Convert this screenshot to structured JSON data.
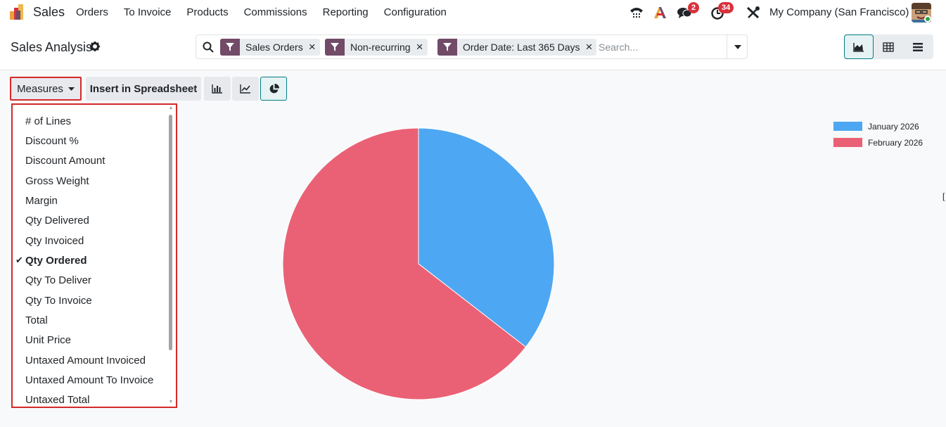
{
  "navbar": {
    "app_name": "Sales",
    "menu": [
      "Orders",
      "To Invoice",
      "Products",
      "Commissions",
      "Reporting",
      "Configuration"
    ],
    "messages_badge": "2",
    "activities_badge": "34",
    "company": "My Company (San Francisco)"
  },
  "control": {
    "title": "Sales Analysis",
    "facets": [
      "Sales Orders",
      "Non-recurring",
      "Order Date: Last 365 Days"
    ],
    "search_placeholder": "Search..."
  },
  "toolbar": {
    "measures_label": "Measures",
    "insert_label": "Insert in Spreadsheet"
  },
  "measures": {
    "items": [
      "# of Lines",
      "Discount %",
      "Discount Amount",
      "Gross Weight",
      "Margin",
      "Qty Delivered",
      "Qty Invoiced",
      "Qty Ordered",
      "Qty To Deliver",
      "Qty To Invoice",
      "Total",
      "Unit Price",
      "Untaxed Amount Invoiced",
      "Untaxed Amount To Invoice",
      "Untaxed Total"
    ],
    "selected": "Qty Ordered"
  },
  "colors": {
    "accent": "#017e84",
    "facet": "#714b67",
    "highlight": "#d62828",
    "january": "#4ea7f2",
    "february": "#ea6175"
  },
  "chart_data": {
    "type": "pie",
    "labels": [
      "January 2026",
      "February 2026"
    ],
    "values": [
      35.5,
      64.5
    ],
    "legend_position": "top-right"
  }
}
